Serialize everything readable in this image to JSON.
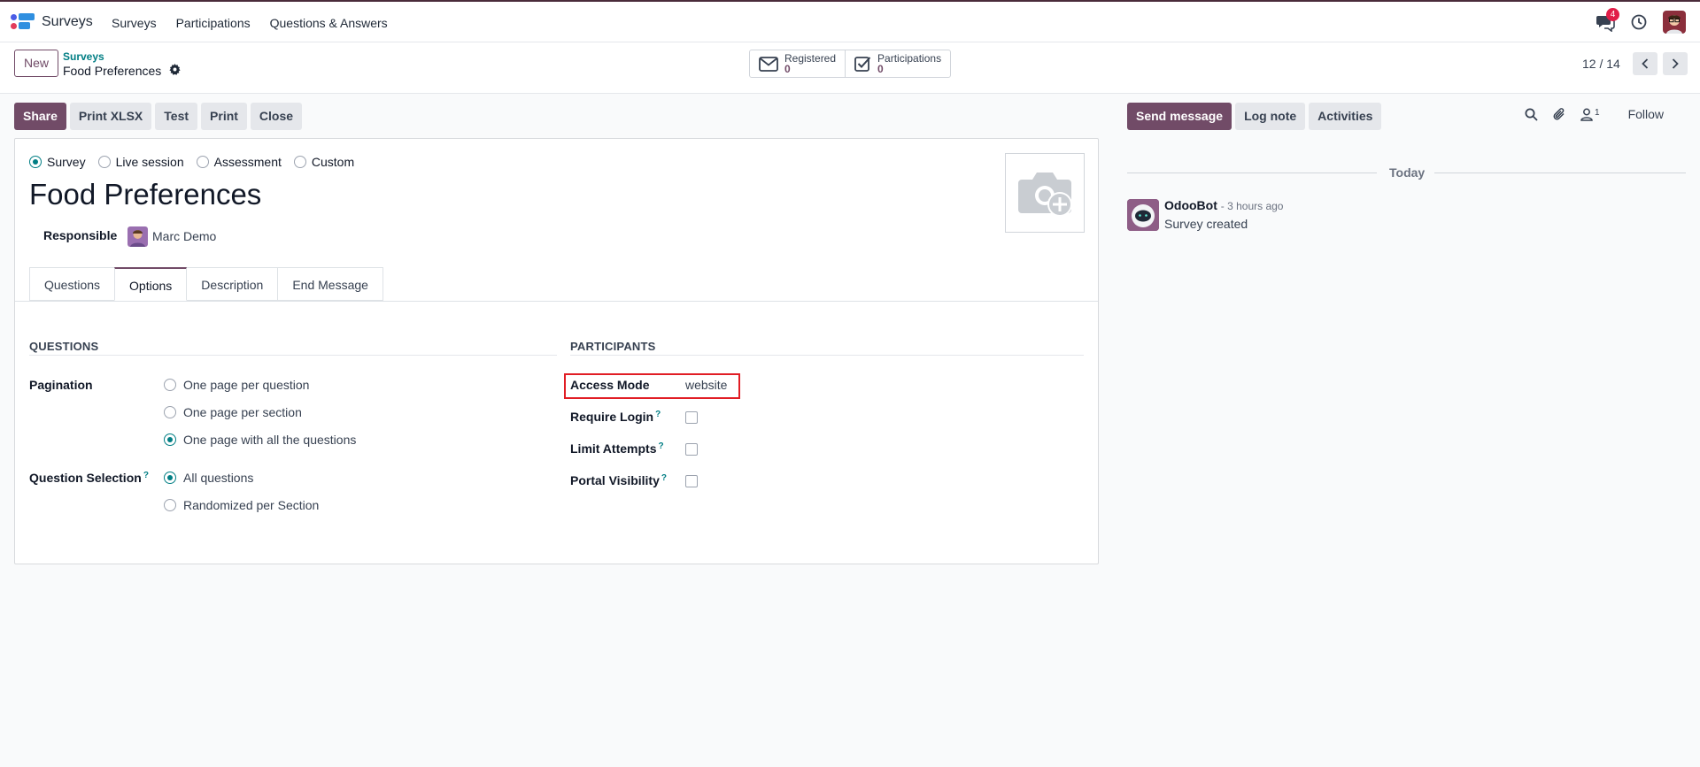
{
  "app": {
    "name": "Surveys"
  },
  "nav": {
    "items": [
      "Surveys",
      "Participations",
      "Questions & Answers"
    ]
  },
  "systray": {
    "messages_count": "4"
  },
  "control_panel": {
    "new_label": "New",
    "breadcrumb_parent": "Surveys",
    "breadcrumb_current": "Food Preferences",
    "stats": [
      {
        "label": "Registered",
        "value": "0"
      },
      {
        "label": "Participations",
        "value": "0"
      }
    ],
    "pager": "12 / 14"
  },
  "actions": {
    "share": "Share",
    "print_xlsx": "Print XLSX",
    "test": "Test",
    "print": "Print",
    "close": "Close"
  },
  "form": {
    "survey_types": [
      {
        "label": "Survey",
        "checked": true
      },
      {
        "label": "Live session",
        "checked": false
      },
      {
        "label": "Assessment",
        "checked": false
      },
      {
        "label": "Custom",
        "checked": false
      }
    ],
    "title": "Food Preferences",
    "responsible_label": "Responsible",
    "responsible_name": "Marc Demo",
    "tabs": [
      "Questions",
      "Options",
      "Description",
      "End Message"
    ],
    "active_tab": "Options",
    "questions_section": {
      "title": "QUESTIONS",
      "pagination_label": "Pagination",
      "pagination_options": [
        "One page per question",
        "One page per section",
        "One page with all the questions"
      ],
      "pagination_selected": 2,
      "selection_label": "Question Selection",
      "selection_help": "?",
      "selection_options": [
        "All questions",
        "Randomized per Section"
      ],
      "selection_selected": 0
    },
    "participants_section": {
      "title": "PARTICIPANTS",
      "access_mode_label": "Access Mode",
      "access_mode_value": "website",
      "require_login_label": "Require Login",
      "limit_attempts_label": "Limit Attempts",
      "portal_visibility_label": "Portal Visibility",
      "help": "?"
    }
  },
  "chatter": {
    "send_message": "Send message",
    "log_note": "Log note",
    "activities": "Activities",
    "followers_count": "1",
    "follow": "Follow",
    "date_separator": "Today",
    "message": {
      "author": "OdooBot",
      "time": "- 3 hours ago",
      "body": "Survey created"
    }
  }
}
